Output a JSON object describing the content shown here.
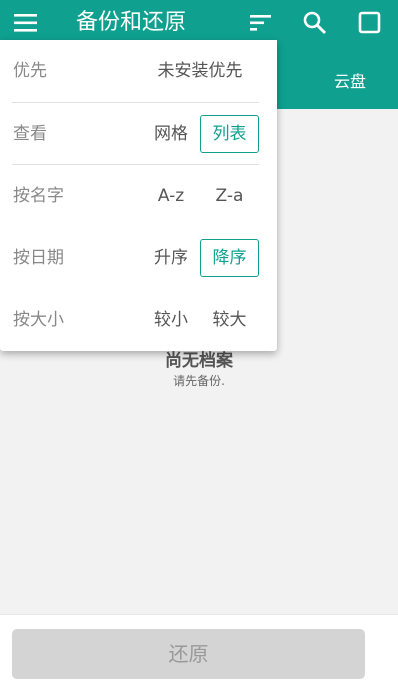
{
  "app_bar": {
    "title": "备份和还原",
    "menu_icon": "menu-icon",
    "sort_icon": "sort-icon",
    "search_icon": "search-icon",
    "select_icon": "checkbox-icon",
    "accent_color": "#0fa08f"
  },
  "tabs": {
    "cloud": "云盘"
  },
  "dropdown": {
    "priority": {
      "label": "优先",
      "options": [
        "未安装优先"
      ]
    },
    "view": {
      "label": "查看",
      "options": [
        "网格",
        "列表"
      ],
      "selected": "列表"
    },
    "by_name": {
      "label": "按名字",
      "options": [
        "A-z",
        "Z-a"
      ]
    },
    "by_date": {
      "label": "按日期",
      "options": [
        "升序",
        "降序"
      ],
      "selected": "降序"
    },
    "by_size": {
      "label": "按大小",
      "options": [
        "较小",
        "较大"
      ]
    }
  },
  "empty_state": {
    "title": "尚无档案",
    "subtitle": "请先备份."
  },
  "bottom": {
    "restore_label": "还原"
  }
}
